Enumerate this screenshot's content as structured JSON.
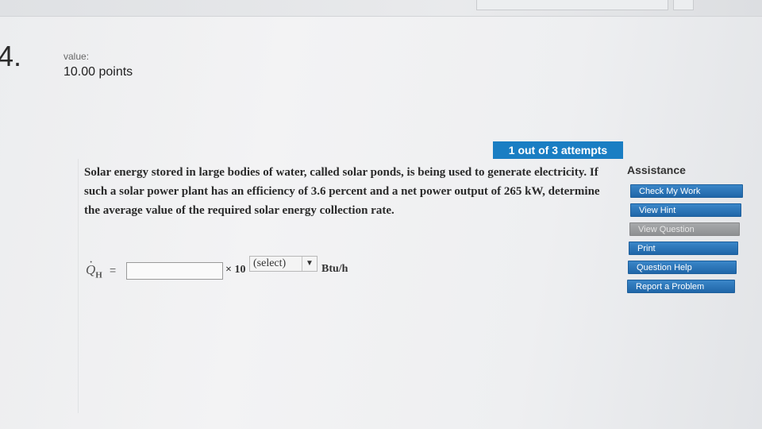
{
  "question": {
    "number": "4.",
    "value_label": "value:",
    "value_points": "10.00 points"
  },
  "attempts": {
    "label": "1 out of 3 attempts"
  },
  "problem": {
    "text": "Solar energy stored in large bodies of water, called solar ponds, is being used to generate electricity. If such a solar power plant has an efficiency of 3.6 percent and a net power output of 265 kW, determine the average value of the required solar energy collection rate."
  },
  "answer": {
    "symbol": "Q",
    "symbol_subscript": "H",
    "equals": "=",
    "input_value": "",
    "times_ten": "× 10",
    "exponent_selected": "(select)",
    "unit": "Btu/h"
  },
  "assistance": {
    "title": "Assistance",
    "buttons": [
      {
        "label": "Check My Work",
        "enabled": true
      },
      {
        "label": "View Hint",
        "enabled": true
      },
      {
        "label": "View Question",
        "enabled": false
      },
      {
        "label": "Print",
        "enabled": true
      },
      {
        "label": "Question Help",
        "enabled": true
      },
      {
        "label": "Report a Problem",
        "enabled": true
      }
    ]
  },
  "colors": {
    "accent": "#1a7ec3",
    "button_blue": "#2a72b5",
    "button_disabled": "#999b9d"
  }
}
